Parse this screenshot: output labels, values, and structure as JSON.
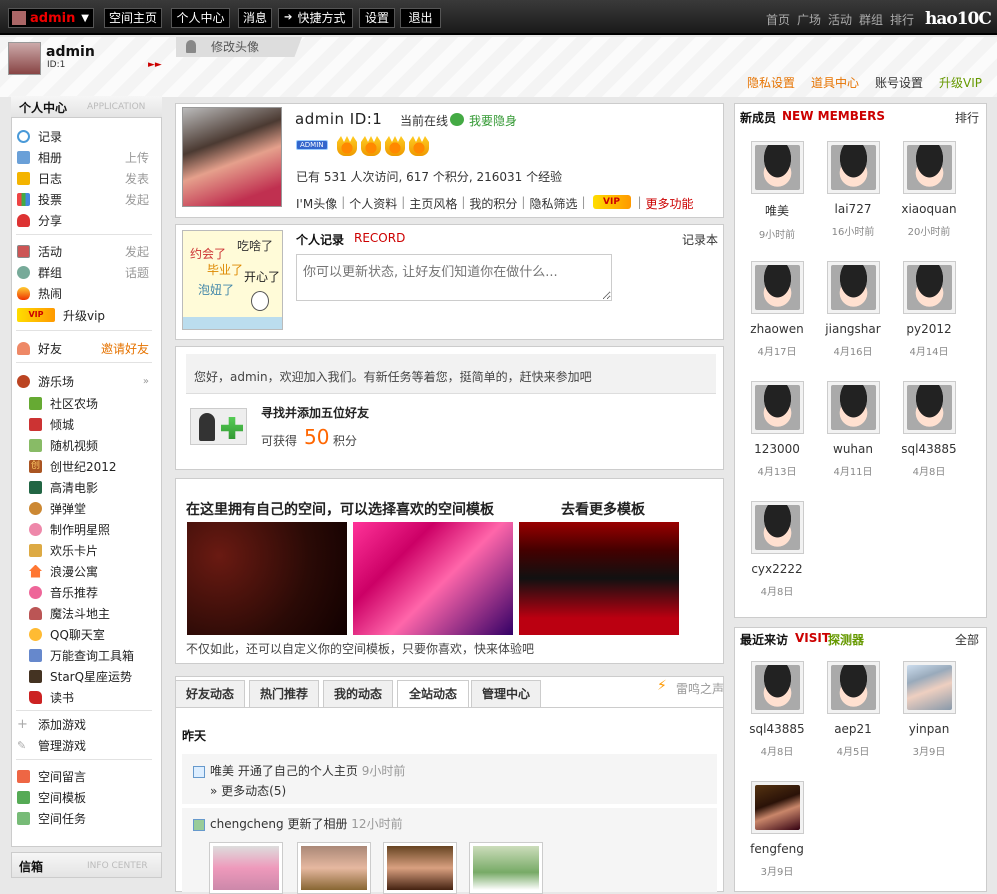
{
  "topbar": {
    "username": "admin",
    "buttons": [
      "空间主页",
      "个人中心",
      "消息",
      "快捷方式",
      "设置",
      "退出"
    ],
    "links": [
      "首页",
      "广场",
      "活动",
      "群组",
      "排行"
    ],
    "logo": "hao10C"
  },
  "header": {
    "name": "admin",
    "id": "ID:1",
    "edit_avatar": "修改头像",
    "links": [
      "隐私设置",
      "道具中心",
      "账号设置",
      "升级VIP"
    ],
    "link_colors": [
      "#e67300",
      "#e67300",
      "#333333",
      "#669900"
    ]
  },
  "left": {
    "title": "个人中心",
    "subtitle": "APPLICATION",
    "items": [
      {
        "label": "记录",
        "extra": ""
      },
      {
        "label": "相册",
        "extra": "上传"
      },
      {
        "label": "日志",
        "extra": "发表"
      },
      {
        "label": "投票",
        "extra": "发起"
      },
      {
        "label": "分享",
        "extra": ""
      }
    ],
    "items2": [
      {
        "label": "活动",
        "extra": "发起"
      },
      {
        "label": "群组",
        "extra": "话题"
      },
      {
        "label": "热闹",
        "extra": ""
      },
      {
        "label": "升级vip",
        "extra": ""
      }
    ],
    "friends": "好友",
    "invite": "邀请好友",
    "playground": "游乐场",
    "games": [
      "社区农场",
      "倾城",
      "随机视频",
      "创世纪2012",
      "高清电影",
      "弹弹堂",
      "制作明星照",
      "欢乐卡片",
      "浪漫公寓",
      "音乐推荐",
      "魔法斗地主",
      "QQ聊天室",
      "万能查询工具箱",
      "StarQ星座运势",
      "读书"
    ],
    "manage": [
      "添加游戏",
      "管理游戏"
    ],
    "space": [
      "空间留言",
      "空间模板",
      "空间任务"
    ],
    "info_title": "信箱",
    "info_subtitle": "INFO CENTER"
  },
  "profile": {
    "name_id": "admin  ID:1",
    "online": "当前在线",
    "hide": "我要隐身",
    "badge": "ADMIN",
    "stats": "已有 531 人次访问, 617 个积分, 216031 个经验",
    "links": [
      "I'M头像",
      "个人资料",
      "主页风格",
      "我的积分",
      "隐私筛选"
    ],
    "vip": "VIP",
    "more": "更多功能"
  },
  "record": {
    "title": "个人记录",
    "title_en": "RECORD",
    "book": "记录本",
    "placeholder": "你可以更新状态, 让好友们知道你在做什么...",
    "bubbles": [
      "约会了",
      "吃啥了",
      "毕业了",
      "开心了",
      "泡妞了"
    ]
  },
  "task": {
    "greeting": "您好，admin，欢迎加入我们。有新任务等着您，挺简单的，赶快来参加吧",
    "title": "寻找并添加五位好友",
    "earn": "可获得",
    "points": "50",
    "unit": "积分"
  },
  "templates": {
    "title": "在这里拥有自己的空间，可以选择喜欢的空间模板",
    "more": "去看更多模板",
    "desc": "不仅如此，还可以自定义你的空间模板，只要你喜欢，快来体验吧"
  },
  "feed": {
    "tabs": [
      "好友动态",
      "热门推荐",
      "我的动态",
      "全站动态",
      "管理中心"
    ],
    "active_tab": 3,
    "thunder": "雷鸣之声",
    "day": "昨天",
    "items": [
      {
        "user": "唯美",
        "action": "开通了自己的个人主页",
        "time": "9小时前",
        "more": "» 更多动态(5)"
      },
      {
        "user": "chengcheng",
        "action": "更新了相册",
        "time": "12小时前"
      }
    ]
  },
  "new_members": {
    "title": "新成员",
    "title_en": "NEW MEMBERS",
    "right": "排行",
    "members": [
      {
        "name": "唯美",
        "time": "9小时前"
      },
      {
        "name": "lai727",
        "time": "16小时前"
      },
      {
        "name": "xiaoquan",
        "time": "20小时前"
      },
      {
        "name": "zhaowen",
        "time": "4月17日"
      },
      {
        "name": "jiangshar",
        "time": "4月16日"
      },
      {
        "name": "py2012",
        "time": "4月14日"
      },
      {
        "name": "123000",
        "time": "4月13日"
      },
      {
        "name": "wuhan",
        "time": "4月11日"
      },
      {
        "name": "sql43885",
        "time": "4月8日"
      },
      {
        "name": "cyx2222",
        "time": "4月8日"
      }
    ]
  },
  "visitors": {
    "title": "最近来访",
    "title_en": "VISIT",
    "title_green": "探测器",
    "right": "全部",
    "members": [
      {
        "name": "sql43885",
        "time": "4月8日"
      },
      {
        "name": "aep21",
        "time": "4月5日"
      },
      {
        "name": "yinpan",
        "time": "3月9日"
      },
      {
        "name": "fengfeng",
        "time": "3月9日"
      }
    ]
  }
}
